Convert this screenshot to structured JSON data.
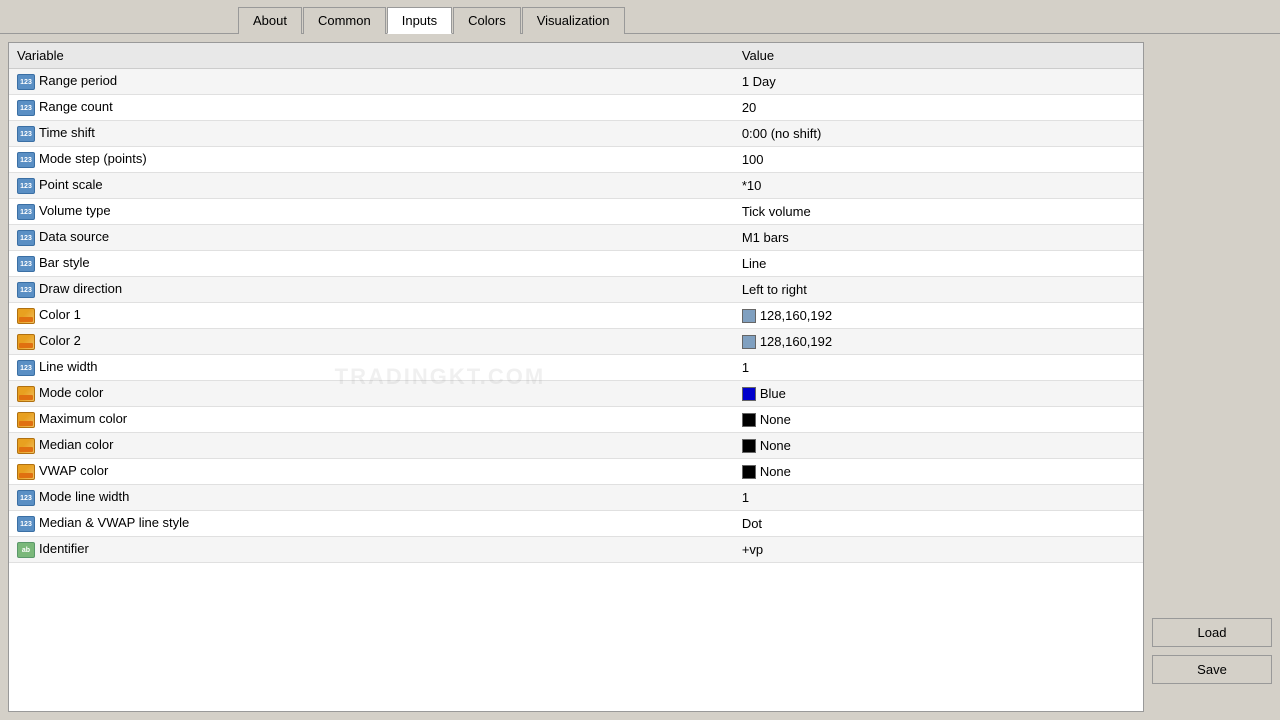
{
  "tabs": [
    {
      "label": "About",
      "active": false
    },
    {
      "label": "Common",
      "active": false
    },
    {
      "label": "Inputs",
      "active": true
    },
    {
      "label": "Colors",
      "active": false
    },
    {
      "label": "Visualization",
      "active": false
    }
  ],
  "table": {
    "col_variable": "Variable",
    "col_value": "Value",
    "rows": [
      {
        "icon": "123",
        "variable": "Range period",
        "value": "1 Day"
      },
      {
        "icon": "123",
        "variable": "Range count",
        "value": "20"
      },
      {
        "icon": "123",
        "variable": "Time shift",
        "value": "0:00 (no shift)"
      },
      {
        "icon": "123",
        "variable": "Mode step (points)",
        "value": "100"
      },
      {
        "icon": "123",
        "variable": "Point scale",
        "value": "*10"
      },
      {
        "icon": "123",
        "variable": "Volume type",
        "value": "Tick volume"
      },
      {
        "icon": "123",
        "variable": "Data source",
        "value": "M1 bars"
      },
      {
        "icon": "123",
        "variable": "Bar style",
        "value": "Line"
      },
      {
        "icon": "123",
        "variable": "Draw direction",
        "value": "Left to right"
      },
      {
        "icon": "color",
        "variable": "Color 1",
        "value": "128,160,192",
        "swatch": "#80a0c0"
      },
      {
        "icon": "color",
        "variable": "Color 2",
        "value": "128,160,192",
        "swatch": "#80a0c0"
      },
      {
        "icon": "123",
        "variable": "Line width",
        "value": "1"
      },
      {
        "icon": "color",
        "variable": "Mode color",
        "value": "Blue",
        "swatch": "#0000cc"
      },
      {
        "icon": "color",
        "variable": "Maximum color",
        "value": "None",
        "swatch": "#000000"
      },
      {
        "icon": "color",
        "variable": "Median color",
        "value": "None",
        "swatch": "#000000"
      },
      {
        "icon": "color",
        "variable": "VWAP color",
        "value": "None",
        "swatch": "#000000"
      },
      {
        "icon": "123",
        "variable": "Mode line width",
        "value": "1"
      },
      {
        "icon": "123",
        "variable": "Median & VWAP line style",
        "value": "Dot"
      },
      {
        "icon": "ab",
        "variable": "Identifier",
        "value": "+vp"
      }
    ]
  },
  "buttons": {
    "load": "Load",
    "save": "Save"
  },
  "watermark": "TRADINGKT.COM"
}
